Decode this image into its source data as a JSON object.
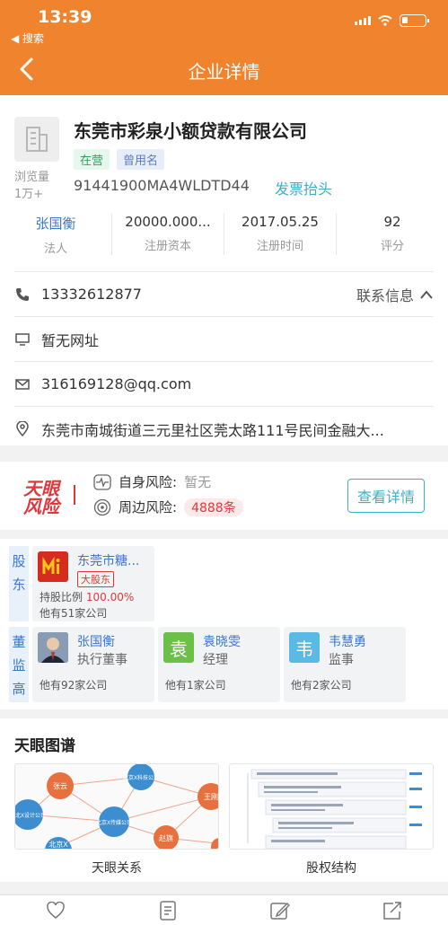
{
  "status": {
    "time": "13:39",
    "back_app": "◀ 搜索"
  },
  "nav": {
    "title": "企业详情"
  },
  "company": {
    "name": "东莞市彩泉小额贷款有限公司",
    "views_label": "浏览量",
    "views_value": "1万+",
    "tags": [
      "在营",
      "曾用名"
    ],
    "credit_code": "91441900MA4WLDTD44",
    "invoice_link": "发票抬头",
    "stats": [
      {
        "value": "张国衡",
        "label": "法人"
      },
      {
        "value": "20000.000...",
        "label": "注册资本"
      },
      {
        "value": "2017.05.25",
        "label": "注册时间"
      },
      {
        "value": "92",
        "label": "评分"
      }
    ],
    "phone": "13332612877",
    "contact_link": "联系信息",
    "website": "暂无网址",
    "email": "316169128@qq.com",
    "address": "东莞市南城街道三元里社区莞太路111号民间金融大..."
  },
  "risk": {
    "logo_line1": "天眼",
    "logo_line2": "风险",
    "self_label": "自身风险:",
    "self_value": "暂无",
    "around_label": "周边风险:",
    "around_value": "4888条",
    "button": "查看详情"
  },
  "shareholders": {
    "label": "股东",
    "items": [
      {
        "name": "东莞市糖...",
        "badge": "大股东",
        "ratio_label": "持股比例",
        "ratio_value": "100.00%",
        "note": "他有51家公司"
      }
    ]
  },
  "executives": {
    "label": "董监高",
    "items": [
      {
        "name": "张国衡",
        "role": "执行董事",
        "note": "他有92家公司",
        "avatar": ""
      },
      {
        "name": "袁晓雯",
        "role": "经理",
        "note": "他有1家公司",
        "avatar": "袁"
      },
      {
        "name": "韦慧勇",
        "role": "监事",
        "note": "他有2家公司",
        "avatar": "韦"
      }
    ]
  },
  "graph": {
    "title": "天眼图谱",
    "items": [
      {
        "label": "天眼关系"
      },
      {
        "label": "股权结构"
      }
    ],
    "nodes": [
      "张云",
      "北京X科技公司",
      "王刚",
      "河北X设计公司",
      "北京X传媒公司",
      "赵旗",
      "北京X"
    ]
  },
  "colors": {
    "brand": "#f0842e",
    "link": "#3bb0c5",
    "name_blue": "#3a78c9",
    "risk_red": "#e0383a"
  }
}
